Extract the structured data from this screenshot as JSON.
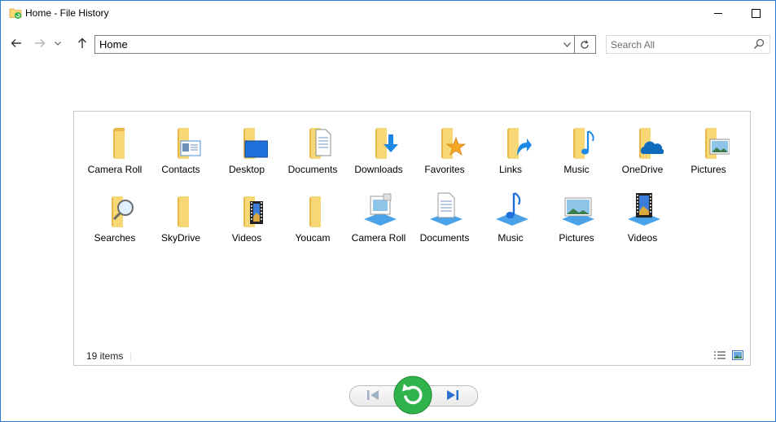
{
  "window": {
    "title": "Home - File History",
    "icon": "file-history-icon"
  },
  "nav": {
    "address": "Home",
    "search_placeholder": "Search All"
  },
  "items": [
    {
      "label": "Camera Roll",
      "icon": "folder-camera-roll-icon"
    },
    {
      "label": "Contacts",
      "icon": "folder-contacts-icon"
    },
    {
      "label": "Desktop",
      "icon": "folder-desktop-icon"
    },
    {
      "label": "Documents",
      "icon": "folder-documents-icon"
    },
    {
      "label": "Downloads",
      "icon": "folder-downloads-icon"
    },
    {
      "label": "Favorites",
      "icon": "folder-favorites-icon"
    },
    {
      "label": "Links",
      "icon": "folder-links-icon"
    },
    {
      "label": "Music",
      "icon": "folder-music-icon"
    },
    {
      "label": "OneDrive",
      "icon": "folder-onedrive-icon"
    },
    {
      "label": "Pictures",
      "icon": "folder-pictures-icon"
    },
    {
      "label": "Searches",
      "icon": "folder-searches-icon"
    },
    {
      "label": "SkyDrive",
      "icon": "folder-skydrive-icon"
    },
    {
      "label": "Videos",
      "icon": "folder-videos-icon"
    },
    {
      "label": "Youcam",
      "icon": "folder-youcam-icon"
    },
    {
      "label": "Camera Roll",
      "icon": "library-camera-roll-icon"
    },
    {
      "label": "Documents",
      "icon": "library-documents-icon"
    },
    {
      "label": "Music",
      "icon": "library-music-icon"
    },
    {
      "label": "Pictures",
      "icon": "library-pictures-icon"
    },
    {
      "label": "Videos",
      "icon": "library-videos-icon"
    }
  ],
  "status": {
    "count": "19 items"
  },
  "playback": {
    "previous": "previous-version-icon",
    "restore": "restore-icon",
    "next": "next-version-icon"
  },
  "colors": {
    "folder": "#f8d775",
    "folder_dark": "#e6b84a",
    "accent_blue": "#1e88e5",
    "restore_green": "#2fb34a",
    "window_border": "#2b7bd6"
  }
}
